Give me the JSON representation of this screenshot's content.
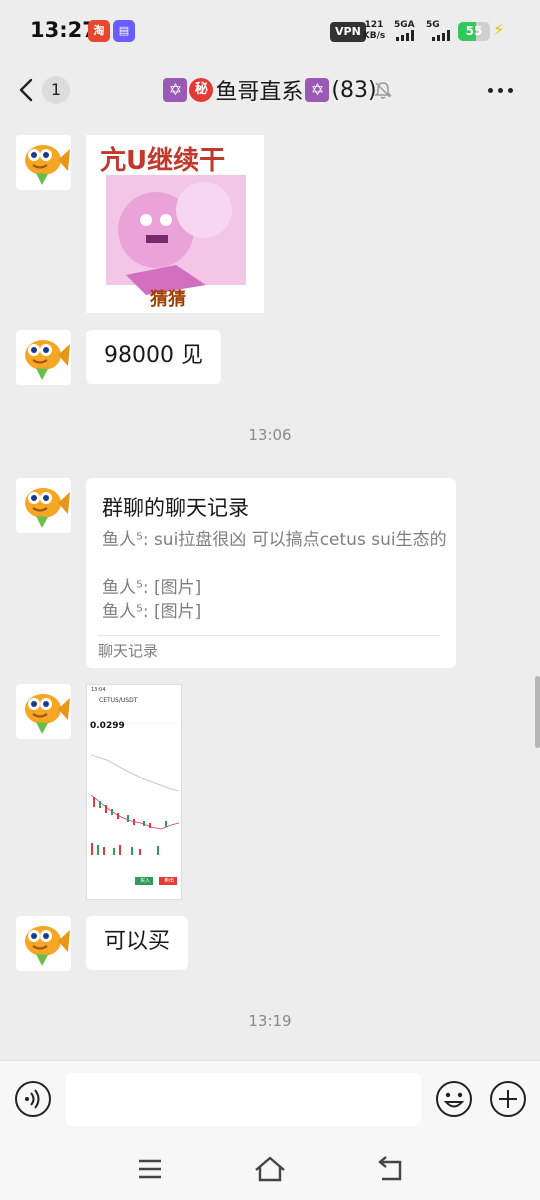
{
  "status_bar": {
    "time": "13:27",
    "vpn": "VPN",
    "net_speed_value": "121",
    "net_speed_unit": "KB/s",
    "sim1_label": "5GA",
    "sim2_label": "5G",
    "battery": "55",
    "battery_level_percent": 55,
    "app_badge_1": "淘",
    "app_badge_2": "▤"
  },
  "header": {
    "unread_count": "1",
    "title_prefix_icon": "✡",
    "secret_icon": "秘",
    "title_name": "鱼哥直系",
    "title_suffix_icon": "✡",
    "member_count": "(83)"
  },
  "sticker": {
    "top_text": "亢U继续干",
    "bottom_text": "猜猜"
  },
  "messages": {
    "msg1": "98000 见",
    "time1": "13:06",
    "record": {
      "title": "群聊的聊天记录",
      "line1": "鱼人⁵: sui拉盘很凶 可以搞点cetus sui生态的",
      "line2": "鱼人⁵: [图片]",
      "line3": "鱼人⁵: [图片]",
      "footer": "聊天记录"
    },
    "msg2": "可以买",
    "time2": "13:19"
  },
  "thumbnail": {
    "time": "13:04",
    "pair": "CETUS/USDT",
    "price": "0.0299",
    "buy": "买入",
    "sell": "卖出"
  },
  "input": {
    "placeholder": ""
  },
  "colors": {
    "background": "#ededed",
    "bubble": "#ffffff",
    "battery_green": "#34c759",
    "secret_red": "#e53935",
    "star_purple": "#9b59b6"
  },
  "icons": [
    "back-chevron-icon",
    "mute-bell-icon",
    "more-dots-icon",
    "voice-icon",
    "emoji-icon",
    "plus-icon",
    "menu-icon",
    "home-icon",
    "back-icon"
  ]
}
